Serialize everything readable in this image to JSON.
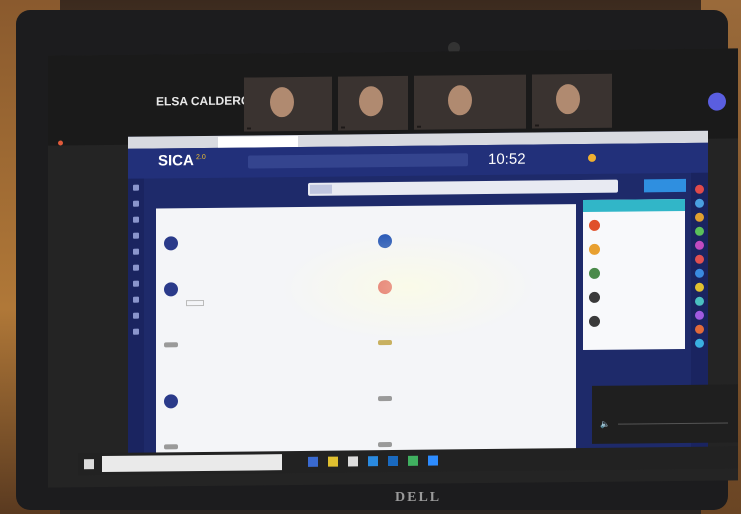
{
  "zoom": {
    "speaker": "ELSA CALDERON",
    "participants": [
      "",
      "",
      "",
      "",
      ""
    ],
    "side_label": ""
  },
  "browser": {
    "tab_label": ""
  },
  "app": {
    "logo": "SICA",
    "logo_badge": "2.0",
    "clock": "10:52",
    "user": "",
    "page_title": "",
    "search_pill": "",
    "search_button": "",
    "content_label": "",
    "cards": [
      {
        "title": "",
        "desc": "",
        "color": "#2a3a8a"
      },
      {
        "title": "",
        "desc": "",
        "color": "#2a5ab8"
      },
      {
        "title": "",
        "desc": "",
        "color": "#2a3a8a"
      },
      {
        "title": "",
        "desc": "",
        "color": "#d83a3a"
      },
      {
        "title": "",
        "desc": "",
        "color": "#9a9a9a"
      },
      {
        "title": "",
        "desc": "",
        "color": "#c8b060"
      },
      {
        "title": "",
        "desc": "",
        "color": "#2a3a8a"
      },
      {
        "title": "",
        "desc": "",
        "color": "#9a9a9a"
      },
      {
        "title": "",
        "desc": "",
        "color": "#9a9a9a"
      },
      {
        "title": "",
        "desc": "",
        "color": "#9a9a9a"
      }
    ],
    "side_panel": {
      "header": "",
      "items": [
        {
          "label": "",
          "color": "#e0502a"
        },
        {
          "label": "",
          "color": "#e8a030"
        },
        {
          "label": "",
          "color": "#4a8a4a"
        },
        {
          "label": "",
          "color": "#3a3a3a"
        },
        {
          "label": "",
          "color": "#3a3a3a"
        }
      ]
    },
    "rail_colors": [
      "#e04a4a",
      "#4aa0e0",
      "#e0a030",
      "#5ac05a",
      "#c04ac0",
      "#e05050",
      "#3a8ae0",
      "#e0c030",
      "#4ac0c0",
      "#a05ae0",
      "#e06a3a",
      "#3ab0e0"
    ]
  },
  "audio": {
    "title": "",
    "icon": "speaker-icon"
  },
  "taskbar": {
    "search_placeholder": "",
    "clock": ""
  },
  "device": {
    "brand": "DELL"
  }
}
